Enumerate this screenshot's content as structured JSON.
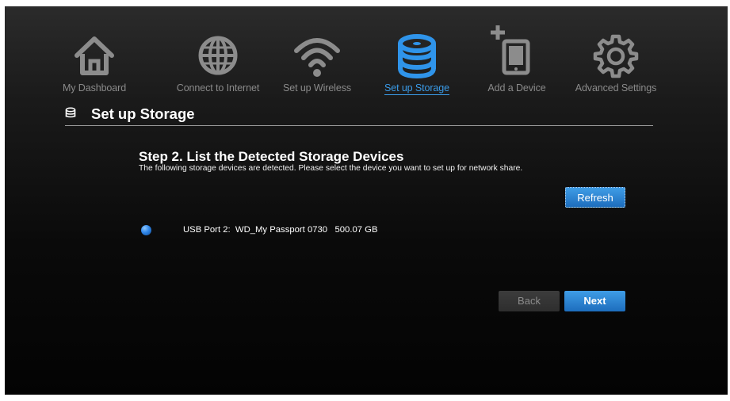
{
  "nav": {
    "items": [
      {
        "label": "My Dashboard",
        "icon": "home-icon"
      },
      {
        "label": "Connect to Internet",
        "icon": "globe-icon"
      },
      {
        "label": "Set up Wireless",
        "icon": "wifi-icon"
      },
      {
        "label": "Set up Storage",
        "icon": "storage-icon",
        "active": true
      },
      {
        "label": "Add a Device",
        "icon": "add-device-icon"
      },
      {
        "label": "Advanced Settings",
        "icon": "gear-icon"
      }
    ]
  },
  "section": {
    "title": "Set up Storage",
    "icon": "storage-small-icon"
  },
  "step": {
    "title": "Step 2. List the Detected Storage Devices",
    "description": "The following storage devices are detected. Please select the device you want to set up for network share."
  },
  "buttons": {
    "refresh": "Refresh",
    "back": "Back",
    "next": "Next"
  },
  "devices": [
    {
      "label": "USB Port 2:  WD_My Passport 0730   500.07 GB",
      "selected": true
    }
  ],
  "colors": {
    "accent": "#3a9be8",
    "icon_gray": "#8c8c8c",
    "background": "#111111"
  }
}
